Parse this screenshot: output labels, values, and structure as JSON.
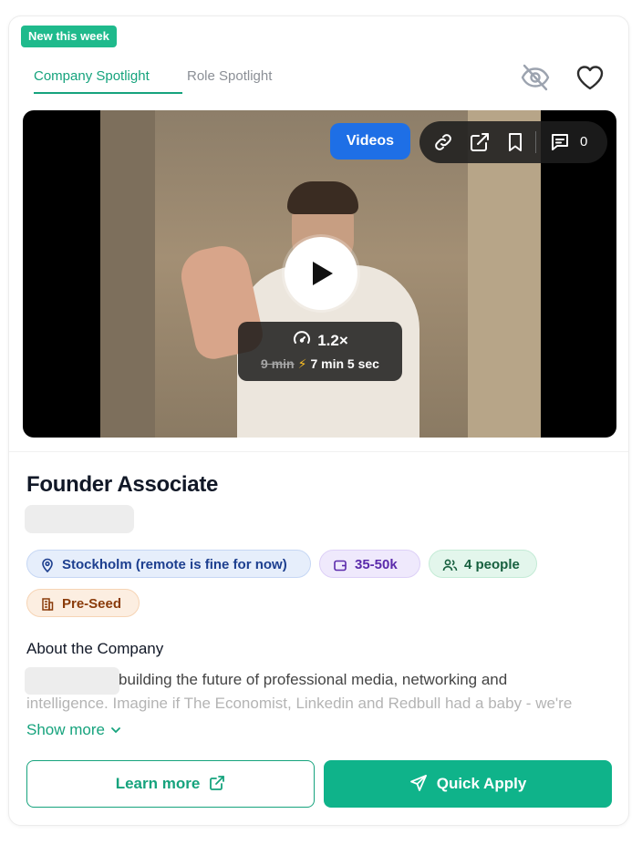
{
  "badge": {
    "new": "New this week"
  },
  "tabs": [
    {
      "label": "Company Spotlight",
      "active": true
    },
    {
      "label": "Role Spotlight",
      "active": false
    }
  ],
  "header_icons": [
    "eye-slash-icon",
    "heart-icon"
  ],
  "video": {
    "videos_label": "Videos",
    "toolbar_icons": [
      "link-icon",
      "external-link-icon",
      "bookmark-icon",
      "comment-icon"
    ],
    "comment_count": "0",
    "speed": "1.2×",
    "original_duration": "9 min",
    "bolt": "⚡",
    "adjusted_duration": "7 min 5 sec"
  },
  "job": {
    "title": "Founder Associate"
  },
  "chips": {
    "location": "Stockholm (remote is fine for now)",
    "salary": "35-50k",
    "team_size": "4 people",
    "stage": "Pre-Seed"
  },
  "about": {
    "heading": "About the Company",
    "line1": "building the future of professional media, networking and",
    "line2": "intelligence. Imagine if The Economist, Linkedin and Redbull had a baby - we're"
  },
  "actions": {
    "show_more": "Show more",
    "learn_more": "Learn more",
    "quick_apply": "Quick Apply"
  },
  "colors": {
    "accent": "#16a37d",
    "badge": "#1fba8c",
    "videos_button": "#1e6fe6",
    "apply_button": "#0fb38a"
  }
}
